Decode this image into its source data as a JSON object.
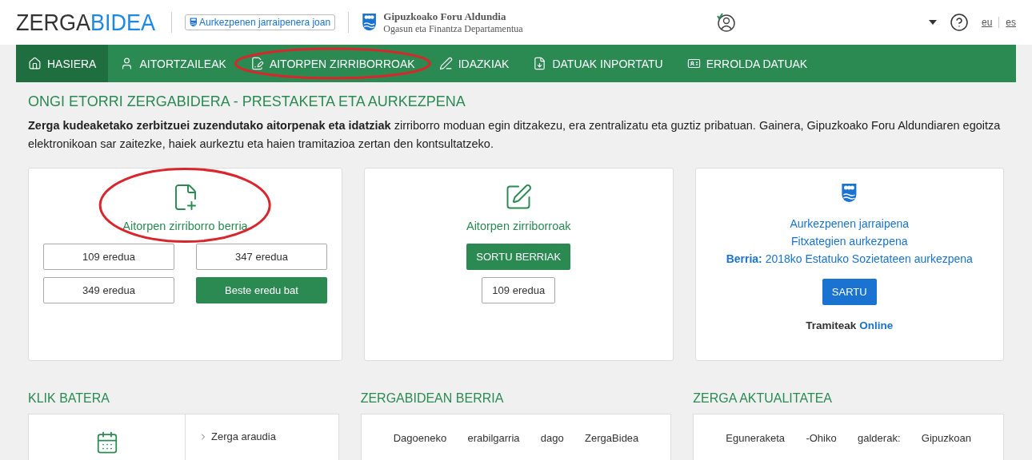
{
  "header": {
    "logo": {
      "part1": "ZERGA",
      "part2": "BIDEA"
    },
    "tracking_link": "Aurkezpenen jarraipenera joan",
    "org": {
      "name": "Gipuzkoako Foru Aldundia",
      "department": "Ogasun eta Finantza Departamentua"
    },
    "languages": [
      "eu",
      "es"
    ]
  },
  "nav": [
    {
      "label": "HASIERA",
      "selected": true,
      "circled": false
    },
    {
      "label": "AITORTZAILEAK",
      "selected": false,
      "circled": false
    },
    {
      "label": "AITORPEN ZIRRIBORROAK",
      "selected": false,
      "circled": true
    },
    {
      "label": "IDAZKIAK",
      "selected": false,
      "circled": false
    },
    {
      "label": "DATUAK INPORTATU",
      "selected": false,
      "circled": false
    },
    {
      "label": "ERROLDA DATUAK",
      "selected": false,
      "circled": false
    }
  ],
  "intro": {
    "title": "ONGI ETORRI ZERGABIDERA - PRESTAKETA ETA AURKEZPENA",
    "text": "**Zerga kudeaketako zerbitzuei zuzendutako aitorpenak eta idatziak** zirriborro moduan egin ditzakezu, era zentralizatu eta guztiz pribatuan. Gainera, Gipuzkoako Foru Aldundiaren egoitza elektronikoan sar zaitezke, haiek aurkeztu eta haien tramitazioa zertan den kontsultatzeko."
  },
  "tiles": [
    {
      "kind": "new",
      "title": "Aitorpen zirriborro berria",
      "circled": true,
      "buttons": [
        {
          "label": "109 eredua",
          "kind": "outline"
        },
        {
          "label": "347 eredua",
          "kind": "outline"
        },
        {
          "label": "349 eredua",
          "kind": "outline"
        },
        {
          "label": "Beste eredu bat",
          "kind": "primary"
        }
      ]
    },
    {
      "kind": "drafts",
      "title": "Aitorpen zirriborroak",
      "circled": false,
      "buttons": [
        {
          "label": "SORTU BERRIAK",
          "kind": "primary"
        },
        {
          "label": "109 eredua",
          "kind": "outline"
        }
      ]
    },
    {
      "kind": "presentation",
      "links": [
        "Aurkezpenen jarraipena",
        "Fitxategien aurkezpena",
        "**Berria:** 2018ko Estatuko Sozietateen aurkezpena"
      ],
      "button": "SARTU",
      "footer": {
        "label": "Tramiteak",
        "link": "Online"
      }
    }
  ],
  "sections": [
    {
      "title": "KLIK BATERA",
      "kind": "links",
      "items": [
        "Zerga araudia"
      ]
    },
    {
      "title": "ZERGABIDEAN BERRIA",
      "kind": "text",
      "text": "Dagoeneko erabilgarria dago ZergaBidea"
    },
    {
      "title": "ZERGA AKTUALITATEA",
      "kind": "text",
      "text": "Eguneraketa -Ohiko galderak: Gipuzkoan"
    }
  ]
}
